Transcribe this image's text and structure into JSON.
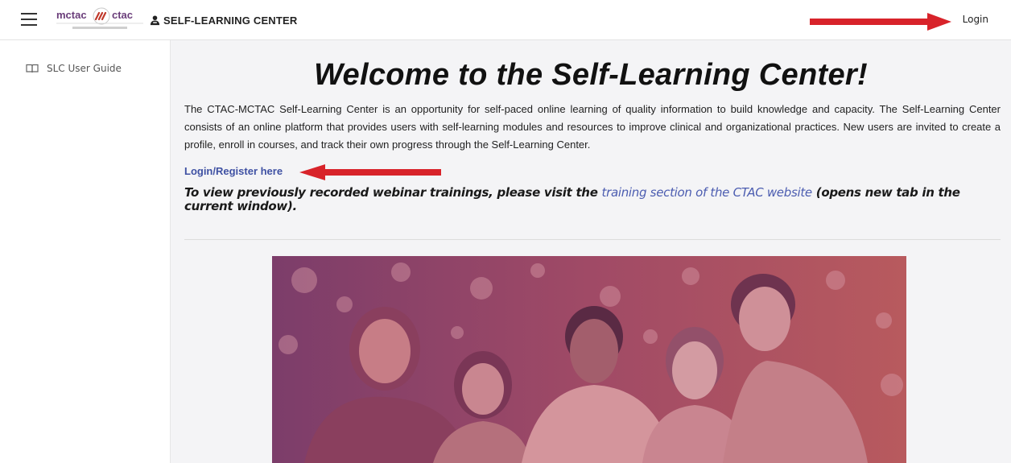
{
  "navbar": {
    "logo_left": "mctac",
    "logo_right": "ctac",
    "brand_title": "SELF-LEARNING CENTER",
    "login_label": "Login",
    "icons": {
      "menu": "hamburger-icon",
      "brand": "person-icon"
    }
  },
  "sidebar": {
    "items": [
      {
        "label": "SLC User Guide",
        "icon": "book-icon"
      }
    ]
  },
  "main": {
    "heading": "Welcome to the Self-Learning Center!",
    "intro": "The CTAC-MCTAC Self-Learning Center is an opportunity for self-paced online learning of quality information to build knowledge and capacity. The Self-Learning Center consists of an online platform that provides users with self-learning modules and resources to improve clinical and organizational practices. New users are invited to create a profile, enroll in courses, and track their own progress through the Self-Learning Center.",
    "register_link": "Login/Register here",
    "webinar_before": "To view previously recorded webinar trainings, please visit the ",
    "webinar_link": "training section of the CTAC website",
    "webinar_after": " (opens new tab in the current window)."
  },
  "colors": {
    "annotation_arrow": "#d8232a",
    "link": "#3f51a3",
    "hero_tint": "#a8465e"
  }
}
